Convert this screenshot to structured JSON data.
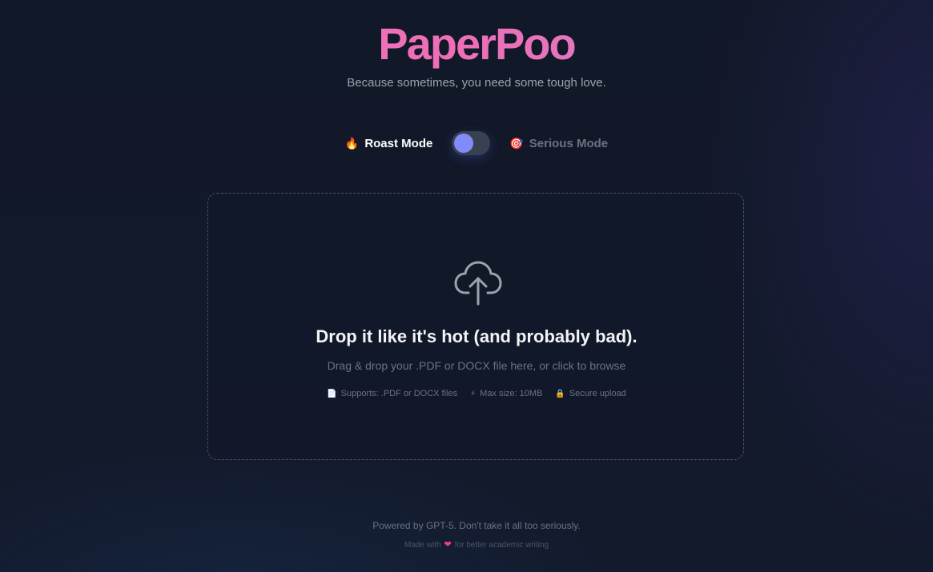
{
  "header": {
    "logo_text": "PaperPoo",
    "tagline": "Because sometimes, you need some tough love."
  },
  "mode_toggle": {
    "roast": {
      "icon": "fire-icon",
      "emoji": "🔥",
      "label": "Roast Mode",
      "active": true
    },
    "serious": {
      "icon": "target-icon",
      "emoji": "🎯",
      "label": "Serious Mode",
      "active": false
    },
    "toggle_color": "#818cf8"
  },
  "upload": {
    "icon": "cloud-upload-icon",
    "title": "Drop it like it's hot (and probably bad).",
    "subtitle": "Drag & drop your .PDF or DOCX file here, or click to browse",
    "features": [
      {
        "icon": "document-icon",
        "emoji": "📄",
        "text": "Supports: .PDF or DOCX files"
      },
      {
        "icon": "lightning-icon",
        "emoji": "⚡",
        "text": "Max size: 10MB"
      },
      {
        "icon": "lock-icon",
        "emoji": "🔒",
        "text": "Secure upload"
      }
    ]
  },
  "footer": {
    "powered_by": "Powered by GPT-5. Don't take it all too seriously.",
    "made_with_prefix": "Made with",
    "heart_emoji": "❤",
    "made_with_suffix": "for better academic writing"
  },
  "colors": {
    "logo_gradient_start": "#f472b6",
    "logo_gradient_end": "#c58bdc",
    "background": "#111827",
    "accent": "#818cf8"
  }
}
